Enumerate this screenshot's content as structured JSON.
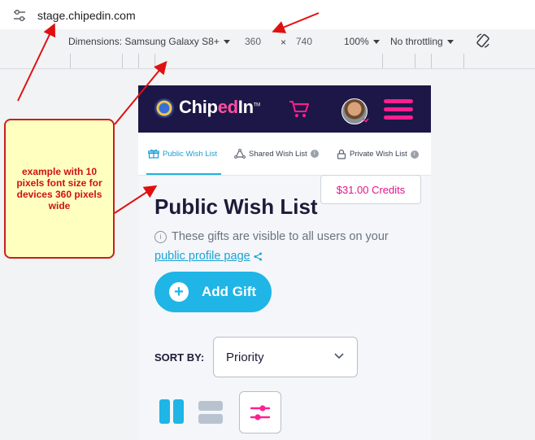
{
  "browser": {
    "url": "stage.chipedin.com"
  },
  "device_toolbar": {
    "dimensions_label": "Dimensions: Samsung Galaxy S8+",
    "width": "360",
    "times": "×",
    "height": "740",
    "zoom": "100%",
    "throttling": "No throttling"
  },
  "app": {
    "logo_chip": "Chip",
    "logo_ed": "ed",
    "logo_in": "In",
    "tabs": [
      {
        "label": "Public Wish List",
        "active": true
      },
      {
        "label": "Shared Wish List",
        "badge": "i"
      },
      {
        "label": "Private Wish List",
        "badge": "i"
      }
    ],
    "credits": "$31.00 Credits",
    "title": "Public Wish List",
    "info_text": "These gifts are visible to all users on your",
    "profile_link": "public profile page",
    "add_gift": "Add Gift",
    "sort_by": "SORT BY:",
    "sort_value": "Priority"
  },
  "callout": {
    "text": "example with 10 pixels font size for devices 360 pixels wide"
  },
  "colors": {
    "header_bg": "#1c1746",
    "accent_pink": "#ff1f8f",
    "accent_blue": "#1fb5e6",
    "annotation_red": "#e01010"
  }
}
